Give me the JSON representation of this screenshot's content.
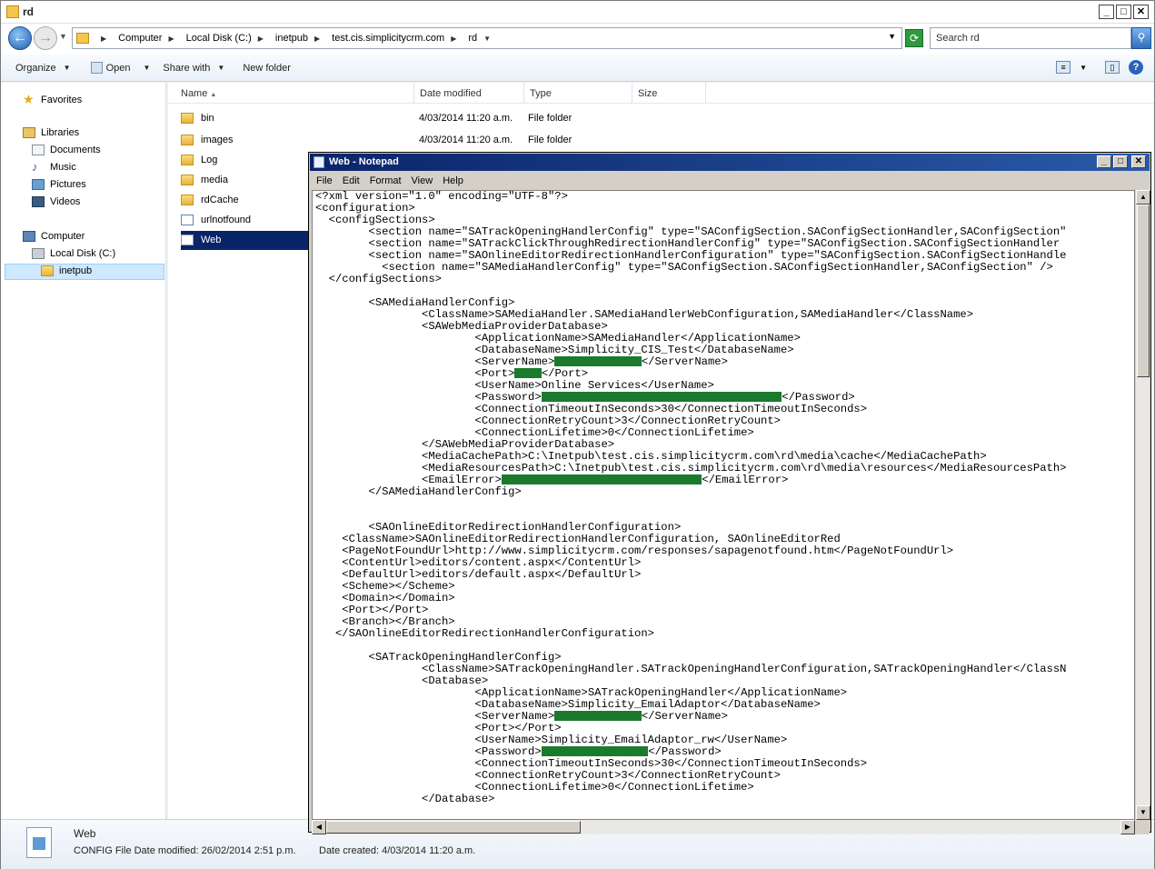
{
  "explorer": {
    "title": "rd",
    "breadcrumb": [
      "Computer",
      "Local Disk (C:)",
      "inetpub",
      "test.cis.simplicitycrm.com",
      "rd"
    ],
    "search_placeholder": "Search rd",
    "toolbar": {
      "organize": "Organize",
      "open": "Open",
      "share_with": "Share with",
      "new_folder": "New folder"
    },
    "nav": {
      "favorites": "Favorites",
      "libraries": "Libraries",
      "documents": "Documents",
      "music": "Music",
      "pictures": "Pictures",
      "videos": "Videos",
      "computer": "Computer",
      "local_disk": "Local Disk (C:)",
      "inetpub": "inetpub"
    },
    "columns": {
      "name": "Name",
      "date_modified": "Date modified",
      "type": "Type",
      "size": "Size"
    },
    "files": [
      {
        "name": "bin",
        "date": "4/03/2014 11:20 a.m.",
        "type": "File folder"
      },
      {
        "name": "images",
        "date": "4/03/2014 11:20 a.m.",
        "type": "File folder"
      },
      {
        "name": "Log",
        "date": "",
        "type": ""
      },
      {
        "name": "media",
        "date": "",
        "type": ""
      },
      {
        "name": "rdCache",
        "date": "",
        "type": ""
      },
      {
        "name": "urlnotfound",
        "date": "",
        "type": ""
      },
      {
        "name": "Web",
        "date": "",
        "type": ""
      }
    ],
    "details": {
      "name": "Web",
      "meta": "CONFIG File Date modified: 26/02/2014 2:51 p.m.",
      "created": "Date created: 4/03/2014 11:20 a.m."
    }
  },
  "notepad": {
    "title": "Web - Notepad",
    "menu": [
      "File",
      "Edit",
      "Format",
      "View",
      "Help"
    ],
    "lines": [
      "<?xml version=\"1.0\" encoding=\"UTF-8\"?>",
      "<configuration>",
      "  <configSections>",
      "        <section name=\"SATrackOpeningHandlerConfig\" type=\"SAConfigSection.SAConfigSectionHandler,SAConfigSection\"",
      "        <section name=\"SATrackClickThroughRedirectionHandlerConfig\" type=\"SAConfigSection.SAConfigSectionHandler",
      "        <section name=\"SAOnlineEditorRedirectionHandlerConfiguration\" type=\"SAConfigSection.SAConfigSectionHandle",
      "          <section name=\"SAMediaHandlerConfig\" type=\"SAConfigSection.SAConfigSectionHandler,SAConfigSection\" />",
      "  </configSections>",
      "",
      "        <SAMediaHandlerConfig>",
      "                <ClassName>SAMediaHandler.SAMediaHandlerWebConfiguration,SAMediaHandler</ClassName>",
      "                <SAWebMediaProviderDatabase>",
      "                        <ApplicationName>SAMediaHandler</ApplicationName>",
      "                        <DatabaseName>Simplicity_CIS_Test</DatabaseName>",
      "                        <ServerName>{R:13}</ServerName>",
      "                        <Port>{R:4}</Port>",
      "                        <UserName>Online Services</UserName>",
      "                        <Password>{R:36}</Password>",
      "                        <ConnectionTimeoutInSeconds>30</ConnectionTimeoutInSeconds>",
      "                        <ConnectionRetryCount>3</ConnectionRetryCount>",
      "                        <ConnectionLifetime>0</ConnectionLifetime>",
      "                </SAWebMediaProviderDatabase>",
      "                <MediaCachePath>C:\\Inetpub\\test.cis.simplicitycrm.com\\rd\\media\\cache</MediaCachePath>",
      "                <MediaResourcesPath>C:\\Inetpub\\test.cis.simplicitycrm.com\\rd\\media\\resources</MediaResourcesPath>",
      "                <EmailError>{R:30}</EmailError>",
      "        </SAMediaHandlerConfig>",
      "",
      "",
      "        <SAOnlineEditorRedirectionHandlerConfiguration>",
      "    <ClassName>SAOnlineEditorRedirectionHandlerConfiguration, SAOnlineEditorRed",
      "    <PageNotFoundUrl>http://www.simplicitycrm.com/responses/sapagenotfound.htm</PageNotFoundUrl>",
      "    <ContentUrl>editors/content.aspx</ContentUrl>",
      "    <DefaultUrl>editors/default.aspx</DefaultUrl>",
      "    <Scheme></Scheme>",
      "    <Domain></Domain>",
      "    <Port></Port>",
      "    <Branch></Branch>",
      "   </SAOnlineEditorRedirectionHandlerConfiguration>",
      "",
      "        <SATrackOpeningHandlerConfig>",
      "                <ClassName>SATrackOpeningHandler.SATrackOpeningHandlerConfiguration,SATrackOpeningHandler</ClassN",
      "                <Database>",
      "                        <ApplicationName>SATrackOpeningHandler</ApplicationName>",
      "                        <DatabaseName>Simplicity_EmailAdaptor</DatabaseName>",
      "                        <ServerName>{R:13}</ServerName>",
      "                        <Port></Port>",
      "                        <UserName>Simplicity_EmailAdaptor_rw</UserName>",
      "                        <Password>{R:16}</Password>",
      "                        <ConnectionTimeoutInSeconds>30</ConnectionTimeoutInSeconds>",
      "                        <ConnectionRetryCount>3</ConnectionRetryCount>",
      "                        <ConnectionLifetime>0</ConnectionLifetime>",
      "                </Database>"
    ]
  }
}
